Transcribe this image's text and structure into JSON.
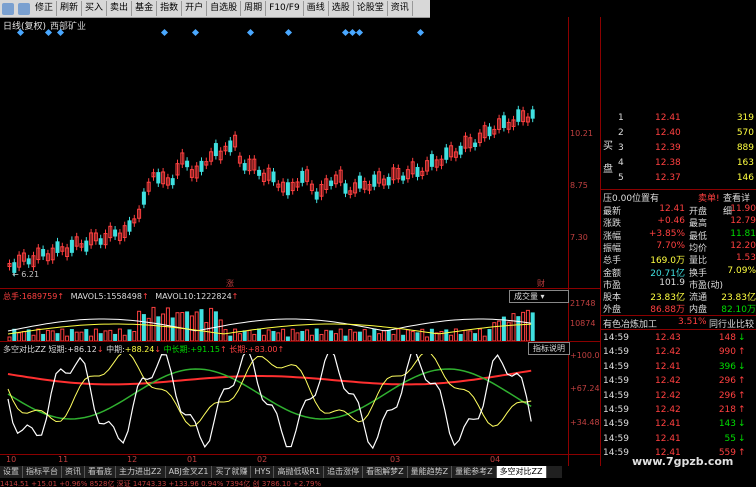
{
  "toolbar": {
    "items": [
      "修正",
      "刷新",
      "买入",
      "卖出",
      "基金",
      "指数",
      "开户",
      "自选股",
      "周期",
      "F10/F9",
      "画线",
      "选股",
      "论股堂",
      "资讯"
    ]
  },
  "chart": {
    "period": "日线(复权)",
    "name": "西部矿业"
  },
  "price_axis": [
    "10.21",
    "8.75",
    "7.30"
  ],
  "low_marker": "6.21",
  "markers": {
    "zhang": "涨",
    "cai": "财"
  },
  "volume": {
    "total_label": "总手:1689759",
    "ma5_label": "MAVOL5:1558498",
    "ma10_label": "MAVOL10:1222824",
    "selector": "成交量",
    "axis": [
      "21748",
      "10874"
    ]
  },
  "indicator": {
    "name": "多空对比ZZ",
    "short_label": "短期:",
    "short_val": "+86.12",
    "mid_label": "中期:",
    "mid_val": "+88.24",
    "mlong_label": "中长期:",
    "mlong_val": "+91.15",
    "long_label": "长期:",
    "long_val": "+83.00",
    "help": "指标说明",
    "axis": [
      "+100.0",
      "+67.24",
      "+34.48"
    ]
  },
  "dates": [
    "10",
    "11",
    "12",
    "01",
    "02",
    "03",
    "04"
  ],
  "tabs": [
    "设置",
    "指标平台",
    "资讯",
    "看看底",
    "主力进出Z2",
    "ABJ金叉Z1",
    "买了就赚",
    "HYS",
    "高抛低吸R1",
    "追击涨停",
    "看图解梦Z",
    "量能趋势Z",
    "量能参考Z",
    "多空对比ZZ"
  ],
  "active_tab": "多空对比ZZ",
  "orderbook": {
    "buy_side_label": "买",
    "sell_side_label": "盘",
    "rows": [
      {
        "n": "1",
        "p": "12.41",
        "v": "319"
      },
      {
        "n": "2",
        "p": "12.40",
        "v": "570"
      },
      {
        "n": "3",
        "p": "12.39",
        "v": "889"
      },
      {
        "n": "4",
        "p": "12.38",
        "v": "163"
      },
      {
        "n": "5",
        "p": "12.37",
        "v": "146"
      }
    ]
  },
  "position_label": "压0.00位置有",
  "sell_button": "卖单!",
  "detail_button": "查看详细",
  "quote": [
    {
      "k": "最新",
      "v": "12.41",
      "k2": "开盘",
      "v2": "11.90",
      "c": "red",
      "c2": "red"
    },
    {
      "k": "涨跌",
      "v": "+0.46",
      "k2": "最高",
      "v2": "12.79",
      "c": "red",
      "c2": "red"
    },
    {
      "k": "涨幅",
      "v": "+3.85%",
      "k2": "最低",
      "v2": "11.81",
      "c": "red",
      "c2": "grn"
    },
    {
      "k": "振幅",
      "v": "7.70%",
      "k2": "均价",
      "v2": "12.20",
      "c": "red",
      "c2": "red"
    },
    {
      "k": "总手",
      "v": "169.0万",
      "k2": "量比",
      "v2": "1.53",
      "c": "yel",
      "c2": "red"
    },
    {
      "k": "金额",
      "v": "20.71亿",
      "k2": "换手",
      "v2": "7.09%",
      "c": "cyan",
      "c2": "yel"
    },
    {
      "k": "市盈",
      "v": "101.9",
      "k2": "市盈(动)",
      "v2": "",
      "c": "wht",
      "c2": "wht"
    },
    {
      "k": "股本",
      "v": "23.83亿",
      "k2": "流通",
      "v2": "23.83亿",
      "c": "yel",
      "c2": "yel"
    },
    {
      "k": "外盘",
      "v": "86.88万",
      "k2": "内盘",
      "v2": "82.10万",
      "c": "red",
      "c2": "grn"
    }
  ],
  "sector": {
    "name": "有色冶炼加工",
    "pct": "3.51%",
    "compare": "同行业比较"
  },
  "trades": [
    {
      "t": "14:59",
      "p": "12.43",
      "v": "148",
      "a": "↓",
      "ac": "grn",
      "vc": "red"
    },
    {
      "t": "14:59",
      "p": "12.42",
      "v": "990",
      "a": "↑",
      "ac": "red",
      "vc": "red"
    },
    {
      "t": "14:59",
      "p": "12.41",
      "v": "396",
      "a": "↓",
      "ac": "grn",
      "vc": "grn"
    },
    {
      "t": "14:59",
      "p": "12.42",
      "v": "296",
      "a": "↑",
      "ac": "red",
      "vc": "red"
    },
    {
      "t": "14:59",
      "p": "12.42",
      "v": "296",
      "a": "↑",
      "ac": "red",
      "vc": "red"
    },
    {
      "t": "14:59",
      "p": "12.42",
      "v": "218",
      "a": "↑",
      "ac": "red",
      "vc": "red"
    },
    {
      "t": "14:59",
      "p": "12.41",
      "v": "143",
      "a": "↓",
      "ac": "grn",
      "vc": "grn"
    },
    {
      "t": "14:59",
      "p": "12.41",
      "v": "55",
      "a": "↓",
      "ac": "grn",
      "vc": "grn"
    },
    {
      "t": "14:59",
      "p": "12.41",
      "v": "559",
      "a": "↑",
      "ac": "red",
      "vc": "red"
    }
  ],
  "watermark": "www.7gpzb.com",
  "statusbar": "1414.51   +15.01   +0.96%   8528亿  深证   14743.33   +133.96   0.94%   7394亿  创   3786.10   +2.79%"
}
